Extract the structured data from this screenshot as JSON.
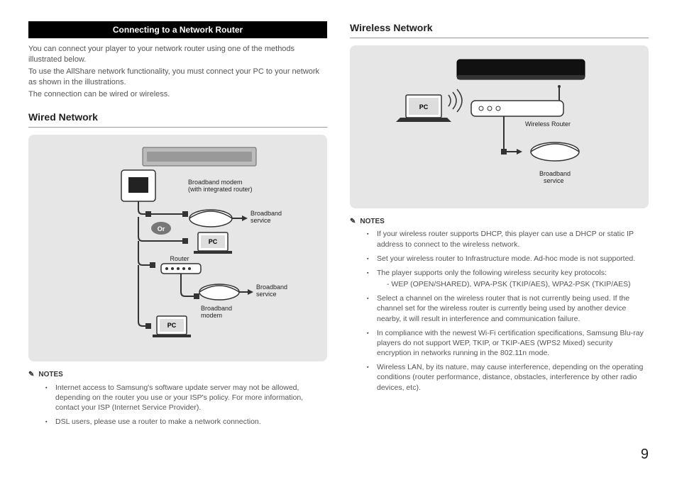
{
  "banner": "Connecting to a Network Router",
  "intro": {
    "p1": "You can connect your player to your network router using one of the methods illustrated below.",
    "p2": "To use the AllShare network functionality, you must connect your PC to your network as shown in the illustrations.",
    "p3": "The connection can be wired or wireless."
  },
  "wired": {
    "heading": "Wired Network",
    "diagram": {
      "modem_integrated": "Broadband modem\n(with integrated router)",
      "broadband_service": "Broadband\nservice",
      "or": "Or",
      "router": "Router",
      "broadband_modem": "Broadband\nmodem",
      "pc": "PC"
    },
    "notes_label": "NOTES",
    "notes": [
      "Internet access to Samsung's software update server may not be allowed, depending on the router you use or your ISP's policy. For more information, contact your ISP (Internet Service Provider).",
      "DSL users, please use a router to make a network connection."
    ]
  },
  "wireless": {
    "heading": "Wireless Network",
    "diagram": {
      "wireless_router": "Wireless Router",
      "broadband_service": "Broadband\nservice",
      "pc": "PC"
    },
    "notes_label": "NOTES",
    "notes": [
      "If your wireless router supports DHCP, this player can use a DHCP or static IP address to connect to the wireless network.",
      "Set your wireless router to Infrastructure mode. Ad-hoc mode is not supported.",
      "The player supports only the following wireless security key protocols:",
      "Select a channel on the wireless router that is not currently being used. If the channel set for the wireless router is currently being used by another device nearby, it will result in interference and communication failure.",
      "In compliance with the newest Wi-Fi certification specifications, Samsung Blu-ray players do not support WEP, TKIP, or TKIP-AES (WPS2 Mixed) security encryption in networks running in the 802.11n mode.",
      "Wireless LAN, by its nature, may cause interference, depending on the operating conditions (router performance, distance, obstacles, interference by other radio devices, etc)."
    ],
    "protocols": "WEP (OPEN/SHARED), WPA-PSK (TKIP/AES),\nWPA2-PSK (TKIP/AES)"
  },
  "page_number": "9"
}
